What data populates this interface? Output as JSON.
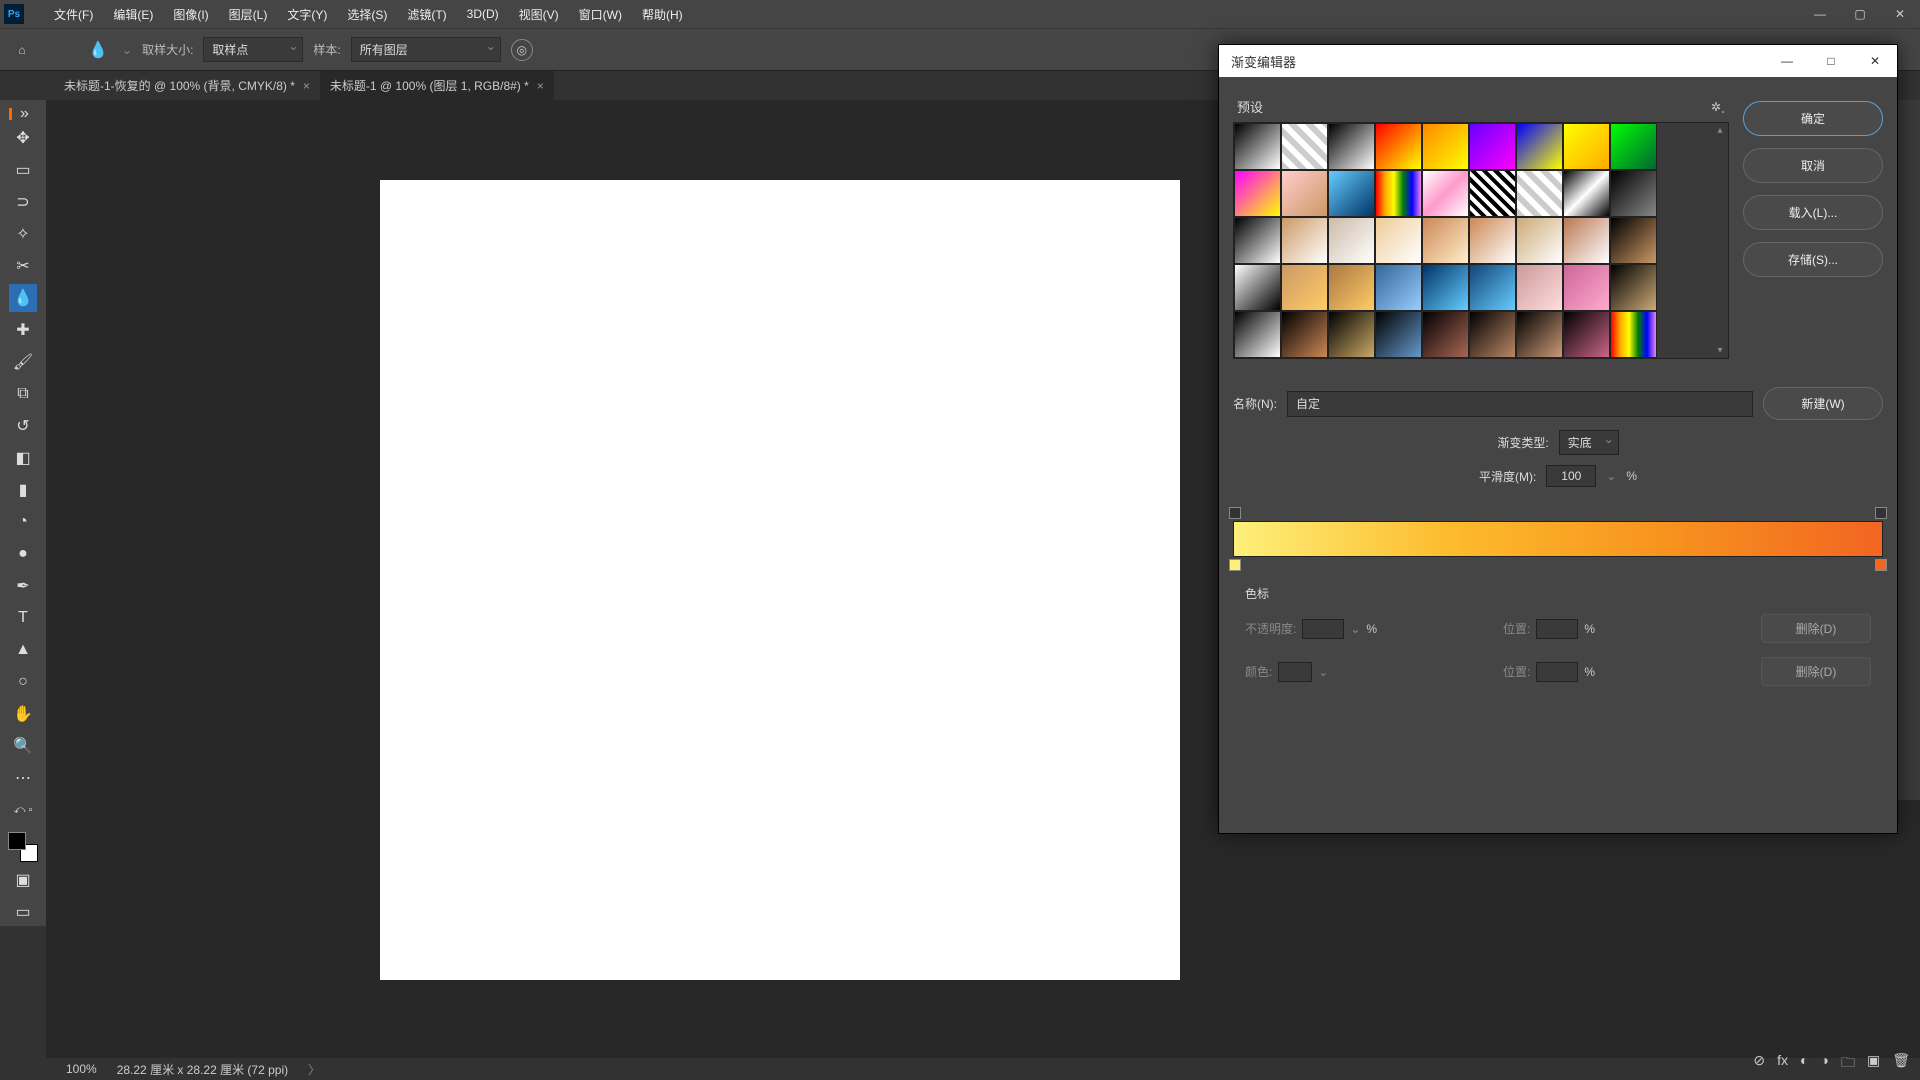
{
  "menu": {
    "file": "文件(F)",
    "edit": "编辑(E)",
    "image": "图像(I)",
    "layer": "图层(L)",
    "type": "文字(Y)",
    "select": "选择(S)",
    "filter": "滤镜(T)",
    "threeD": "3D(D)",
    "view": "视图(V)",
    "window": "窗口(W)",
    "help": "帮助(H)"
  },
  "options": {
    "sample_size_label": "取样大小:",
    "sample_size_value": "取样点",
    "sample_label": "样本:",
    "sample_value": "所有图层"
  },
  "tabs": {
    "t1": "未标题-1-恢复的 @ 100% (背景, CMYK/8) *",
    "t2": "未标题-1 @ 100% (图层 1, RGB/8#) *"
  },
  "status": {
    "zoom": "100%",
    "dims": "28.22 厘米 x 28.22 厘米 (72 ppi)"
  },
  "dlg": {
    "title": "渐变编辑器",
    "presets": "预设",
    "ok": "确定",
    "cancel": "取消",
    "load": "载入(L)...",
    "save": "存储(S)...",
    "name_label": "名称(N):",
    "name_value": "自定",
    "new": "新建(W)",
    "grad_type_label": "渐变类型:",
    "grad_type_value": "实底",
    "smooth_label": "平滑度(M):",
    "smooth_value": "100",
    "stops_title": "色标",
    "opacity_label": "不透明度:",
    "position_label": "位置:",
    "color_label": "颜色:",
    "delete": "删除(D)",
    "pct": "%"
  },
  "chart_data": {
    "type": "gradient",
    "stops": [
      {
        "position": 0,
        "color": "#fdf07a",
        "opacity": 100
      },
      {
        "position": 100,
        "color": "#f26522",
        "opacity": 100
      }
    ]
  }
}
